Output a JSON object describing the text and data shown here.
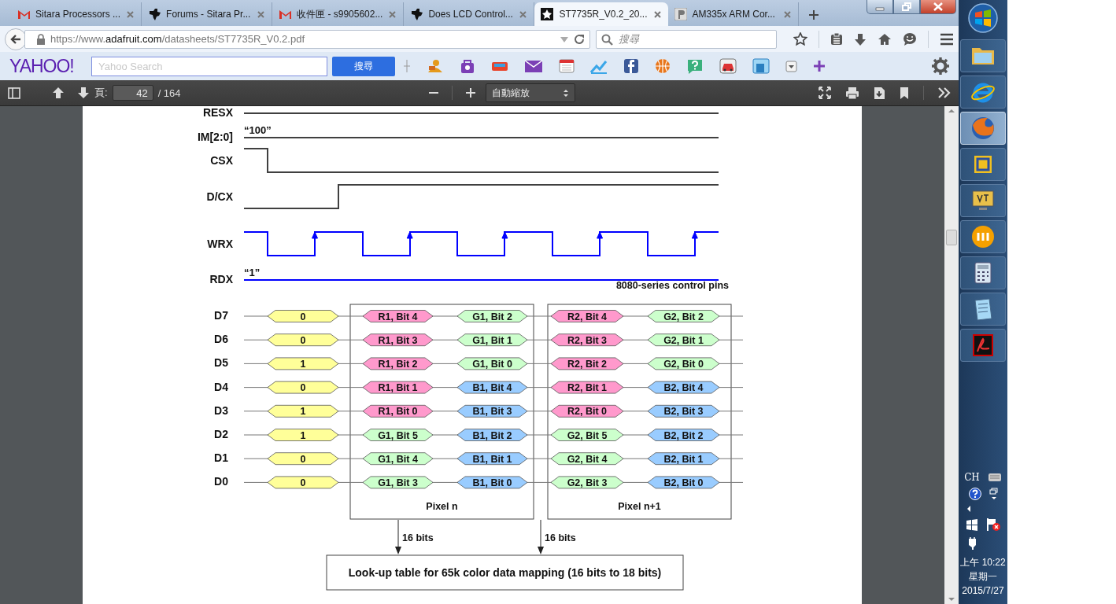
{
  "tabs": [
    {
      "title": "Sitara Processors ...",
      "selected": false
    },
    {
      "title": "Forums - Sitara Pr...",
      "selected": false
    },
    {
      "title": "收件匣 - s9905602...",
      "selected": false
    },
    {
      "title": "Does LCD Control...",
      "selected": false
    },
    {
      "title": "ST7735R_V0.2_20...",
      "selected": true
    },
    {
      "title": "AM335x ARM Cor...",
      "selected": false
    }
  ],
  "address": {
    "prefix": "https://www.",
    "domain": "adafruit.com",
    "path": "/datasheets/ST7735R_V0.2.pdf"
  },
  "search": {
    "placeholder": "搜尋"
  },
  "yahoo": {
    "logo": "YAHOO!",
    "placeholder": "Yahoo Search",
    "button": "搜尋"
  },
  "pdf_toolbar": {
    "page_label": "頁:",
    "page": "42",
    "page_count": "/ 164",
    "zoom": "自動縮放"
  },
  "diagram": {
    "control_signals": [
      {
        "name": "RESX",
        "kind": "flat",
        "color": "#404040"
      },
      {
        "name": "IM[2:0]",
        "kind": "flat",
        "value": "“100”",
        "color": "#404040"
      },
      {
        "name": "CSX",
        "kind": "fall",
        "color": "#404040"
      },
      {
        "name": "D/CX",
        "kind": "rise",
        "color": "#404040"
      },
      {
        "name": "WRX",
        "kind": "clock",
        "color": "#0000ff"
      },
      {
        "name": "RDX",
        "kind": "flat",
        "value": "“1”",
        "color": "#0000ff"
      }
    ],
    "caption": "8080-series control pins",
    "data_lines": [
      {
        "name": "D7",
        "value": "0",
        "fields": [
          {
            "label": "R1, Bit 4",
            "color": "#ff99cc"
          },
          {
            "label": "G1, Bit 2",
            "color": "#ccffcc"
          },
          {
            "label": "R2, Bit 4",
            "color": "#ff99cc"
          },
          {
            "label": "G2, Bit 2",
            "color": "#ccffcc"
          }
        ]
      },
      {
        "name": "D6",
        "value": "0",
        "fields": [
          {
            "label": "R1, Bit 3",
            "color": "#ff99cc"
          },
          {
            "label": "G1, Bit 1",
            "color": "#ccffcc"
          },
          {
            "label": "R2, Bit 3",
            "color": "#ff99cc"
          },
          {
            "label": "G2, Bit 1",
            "color": "#ccffcc"
          }
        ]
      },
      {
        "name": "D5",
        "value": "1",
        "fields": [
          {
            "label": "R1, Bit 2",
            "color": "#ff99cc"
          },
          {
            "label": "G1, Bit 0",
            "color": "#ccffcc"
          },
          {
            "label": "R2, Bit 2",
            "color": "#ff99cc"
          },
          {
            "label": "G2, Bit 0",
            "color": "#ccffcc"
          }
        ]
      },
      {
        "name": "D4",
        "value": "0",
        "fields": [
          {
            "label": "R1, Bit 1",
            "color": "#ff99cc"
          },
          {
            "label": "B1, Bit 4",
            "color": "#99ccff"
          },
          {
            "label": "R2, Bit 1",
            "color": "#ff99cc"
          },
          {
            "label": "B2, Bit 4",
            "color": "#99ccff"
          }
        ]
      },
      {
        "name": "D3",
        "value": "1",
        "fields": [
          {
            "label": "R1, Bit 0",
            "color": "#ff99cc"
          },
          {
            "label": "B1, Bit 3",
            "color": "#99ccff"
          },
          {
            "label": "R2, Bit 0",
            "color": "#ff99cc"
          },
          {
            "label": "B2, Bit 3",
            "color": "#99ccff"
          }
        ]
      },
      {
        "name": "D2",
        "value": "1",
        "fields": [
          {
            "label": "G1, Bit 5",
            "color": "#ccffcc"
          },
          {
            "label": "B1, Bit 2",
            "color": "#99ccff"
          },
          {
            "label": "G2, Bit 5",
            "color": "#ccffcc"
          },
          {
            "label": "B2, Bit 2",
            "color": "#99ccff"
          }
        ]
      },
      {
        "name": "D1",
        "value": "0",
        "fields": [
          {
            "label": "G1, Bit 4",
            "color": "#ccffcc"
          },
          {
            "label": "B1, Bit 1",
            "color": "#99ccff"
          },
          {
            "label": "G2, Bit 4",
            "color": "#ccffcc"
          },
          {
            "label": "B2, Bit 1",
            "color": "#99ccff"
          }
        ]
      },
      {
        "name": "D0",
        "value": "0",
        "fields": [
          {
            "label": "G1, Bit 3",
            "color": "#ccffcc"
          },
          {
            "label": "B1, Bit 0",
            "color": "#99ccff"
          },
          {
            "label": "G2, Bit 3",
            "color": "#ccffcc"
          },
          {
            "label": "B2, Bit 0",
            "color": "#99ccff"
          }
        ]
      }
    ],
    "pixels": [
      "Pixel n",
      "Pixel n+1"
    ],
    "buses": [
      "16 bits",
      "16 bits"
    ],
    "lut": "Look-up table for 65k color data mapping (16 bits to 18 bits)"
  },
  "taskbar": {
    "apps": [
      {
        "selected": false
      },
      {
        "selected": false
      },
      {
        "selected": true
      },
      {
        "selected": false
      },
      {
        "selected": false
      },
      {
        "selected": false
      },
      {
        "selected": false
      },
      {
        "selected": false
      },
      {
        "selected": false
      }
    ],
    "language": "CH",
    "time": "上午 10:22",
    "weekday": "星期一",
    "date": "2015/7/27"
  }
}
